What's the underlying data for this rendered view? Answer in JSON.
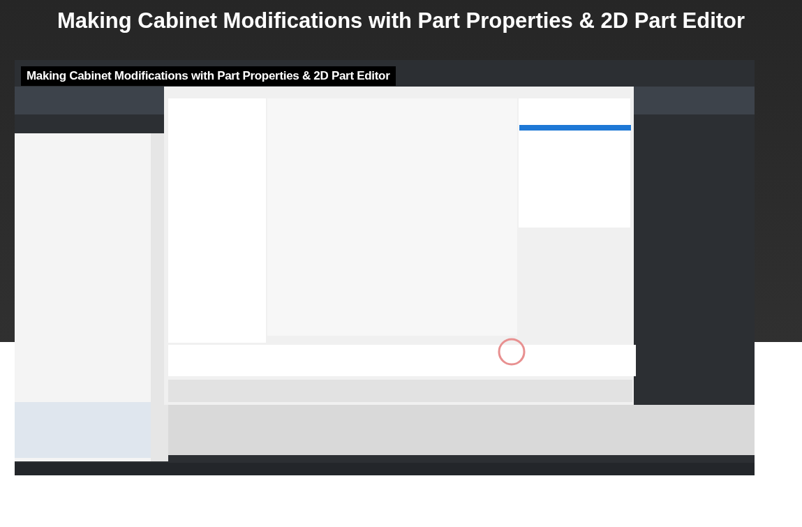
{
  "page_title": "Making Cabinet Modifications with Part Properties & 2D Part Editor",
  "video": {
    "kind": "picture",
    "caption": "Making Cabinet Modifications with Part Properties & 2D Part Editor"
  }
}
